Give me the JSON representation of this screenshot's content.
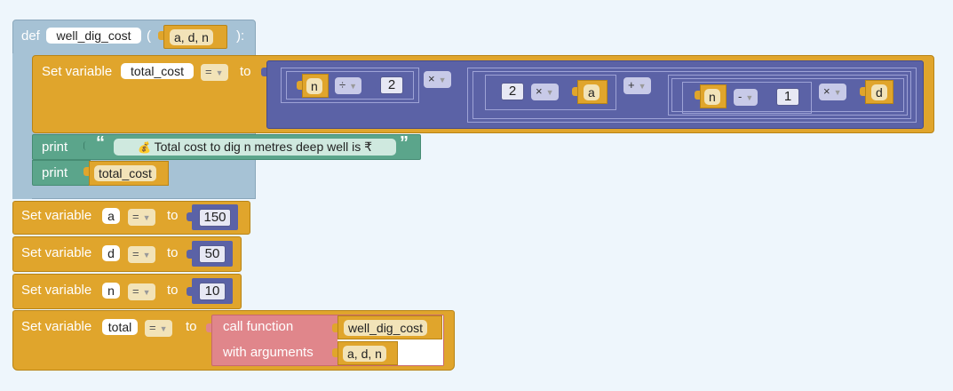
{
  "colors": {
    "background": "#eef6fc",
    "procedure": "#a6c2d5",
    "variable": "#e0a52c",
    "math": "#5b62a6",
    "text": "#5ba58b",
    "function_call": "#e0868b"
  },
  "procedure": {
    "def_keyword": "def",
    "name": "well_dig_cost",
    "open_paren": "(",
    "params": "a, d, n",
    "close_paren": "):"
  },
  "set_total_cost": {
    "label": "Set variable",
    "var": "total_cost",
    "op": "=",
    "to": "to"
  },
  "expression": {
    "n1": "n",
    "div": "÷",
    "two1": "2",
    "mul1": "×",
    "two2": "2",
    "mul2": "×",
    "a": "a",
    "plus": "+",
    "n2": "n",
    "minus": "-",
    "one": "1",
    "mul3": "×",
    "d": "d"
  },
  "print1": {
    "label": "print",
    "open_quote": "“",
    "emoji": "💰",
    "text": "Total cost to dig n metres deep well is ₹",
    "close_quote": "”"
  },
  "print2": {
    "label": "print",
    "var": "total_cost"
  },
  "set_a": {
    "label": "Set variable",
    "var": "a",
    "op": "=",
    "to": "to",
    "value": "150"
  },
  "set_d": {
    "label": "Set variable",
    "var": "d",
    "op": "=",
    "to": "to",
    "value": "50"
  },
  "set_n": {
    "label": "Set variable",
    "var": "n",
    "op": "=",
    "to": "to",
    "value": "10"
  },
  "set_total": {
    "label": "Set variable",
    "var": "total",
    "op": "=",
    "to": "to",
    "call_label": "call function",
    "args_label": "with arguments",
    "func_name": "well_dig_cost",
    "args": "a, d, n"
  }
}
